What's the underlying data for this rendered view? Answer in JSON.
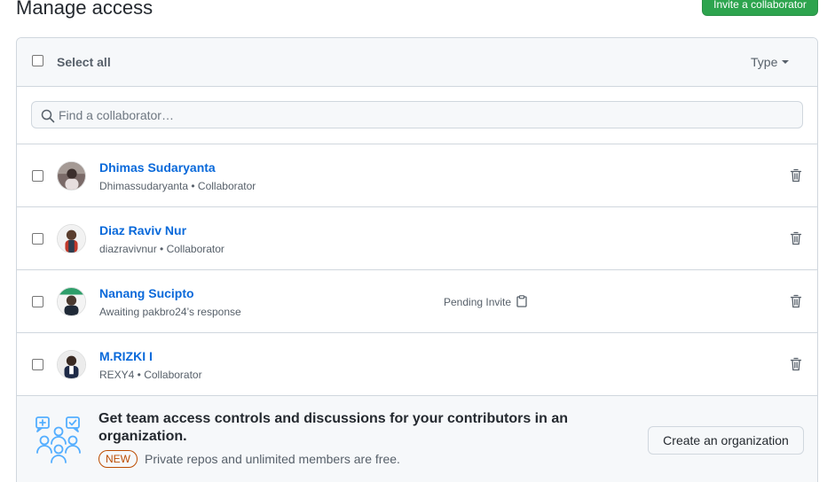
{
  "header": {
    "title": "Manage access",
    "invite_button": "Invite a collaborator"
  },
  "toolbar": {
    "select_all_label": "Select all",
    "type_filter_label": "Type"
  },
  "search": {
    "placeholder": "Find a collaborator…"
  },
  "members": [
    {
      "name": "Dhimas Sudaryanta",
      "subtitle": "Dhimassudaryanta • Collaborator",
      "pending": "",
      "avatar_color": "#7a6a68"
    },
    {
      "name": "Diaz Raviv Nur",
      "subtitle": "diazravivnur • Collaborator",
      "pending": "",
      "avatar_color": "#d9d9d9"
    },
    {
      "name": "Nanang Sucipto",
      "subtitle": "Awaiting pakbro24’s response",
      "pending": "Pending Invite",
      "avatar_color": "#2e9e6a"
    },
    {
      "name": "M.RIZKI I",
      "subtitle": "REXY4 • Collaborator",
      "pending": "",
      "avatar_color": "#e6e6e6"
    }
  ],
  "promo": {
    "title": "Get team access controls and discussions for your contributors in an organization.",
    "badge": "NEW",
    "subtitle": "Private repos and unlimited members are free.",
    "button": "Create an organization"
  },
  "colors": {
    "primary_button": "#2da44e",
    "link": "#0969da",
    "badge": "#bc4c00",
    "border": "#d0d7de"
  },
  "icons": {
    "search": "search-icon",
    "trash": "trash-icon",
    "clipboard": "clipboard-icon",
    "caret": "caret-down-icon",
    "org": "organization-illustration"
  }
}
